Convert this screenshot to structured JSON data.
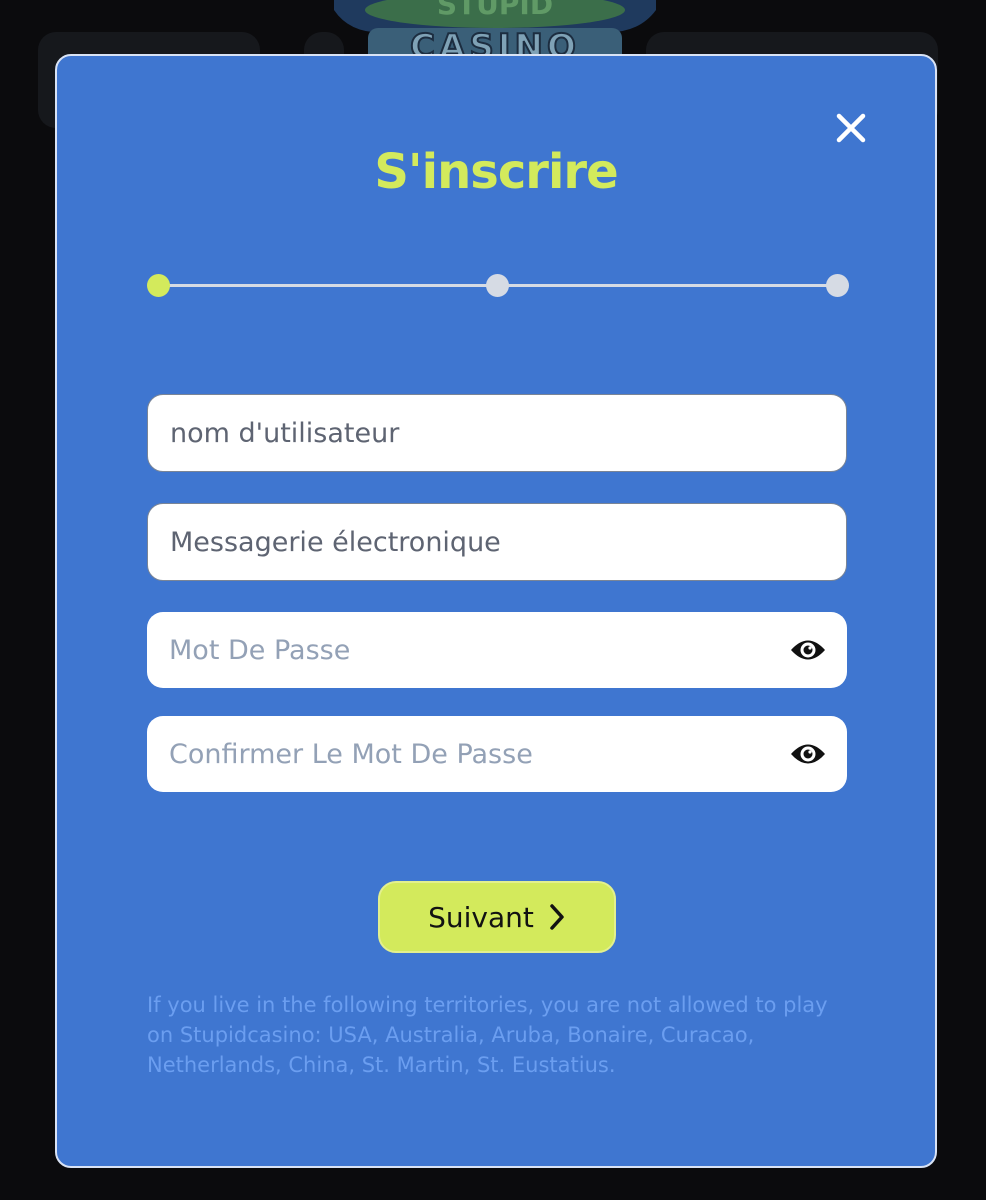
{
  "background": {
    "logo_text": "STUPID CASINO"
  },
  "modal": {
    "title": "S'inscrire",
    "close_icon": "close-icon",
    "stepper": {
      "steps_total": 3,
      "current_step": 1,
      "active_color": "#d3ea5c",
      "inactive_color": "#d6dbe4"
    },
    "fields": {
      "username": {
        "placeholder": "nom d'utilisateur",
        "value": ""
      },
      "email": {
        "placeholder": "Messagerie électronique",
        "value": ""
      },
      "password": {
        "placeholder": "Mot De Passe",
        "value": "",
        "icon": "eye-icon"
      },
      "confirm_password": {
        "placeholder": "Confirmer Le Mot De Passe",
        "value": "",
        "icon": "eye-icon"
      }
    },
    "next_button": {
      "label": "Suivant",
      "icon": "chevron-right-icon"
    },
    "disclaimer": "If you live in the following territories, you are not allowed to play on Stupidcasino: USA, Australia, Aruba, Bonaire, Curacao, Netherlands, China, St. Martin, St. Eustatius."
  },
  "colors": {
    "modal_bg": "#3f76d0",
    "accent": "#d3ea5c",
    "page_bg": "#0b0b0d",
    "disclaimer_text": "#6b9ef0"
  }
}
